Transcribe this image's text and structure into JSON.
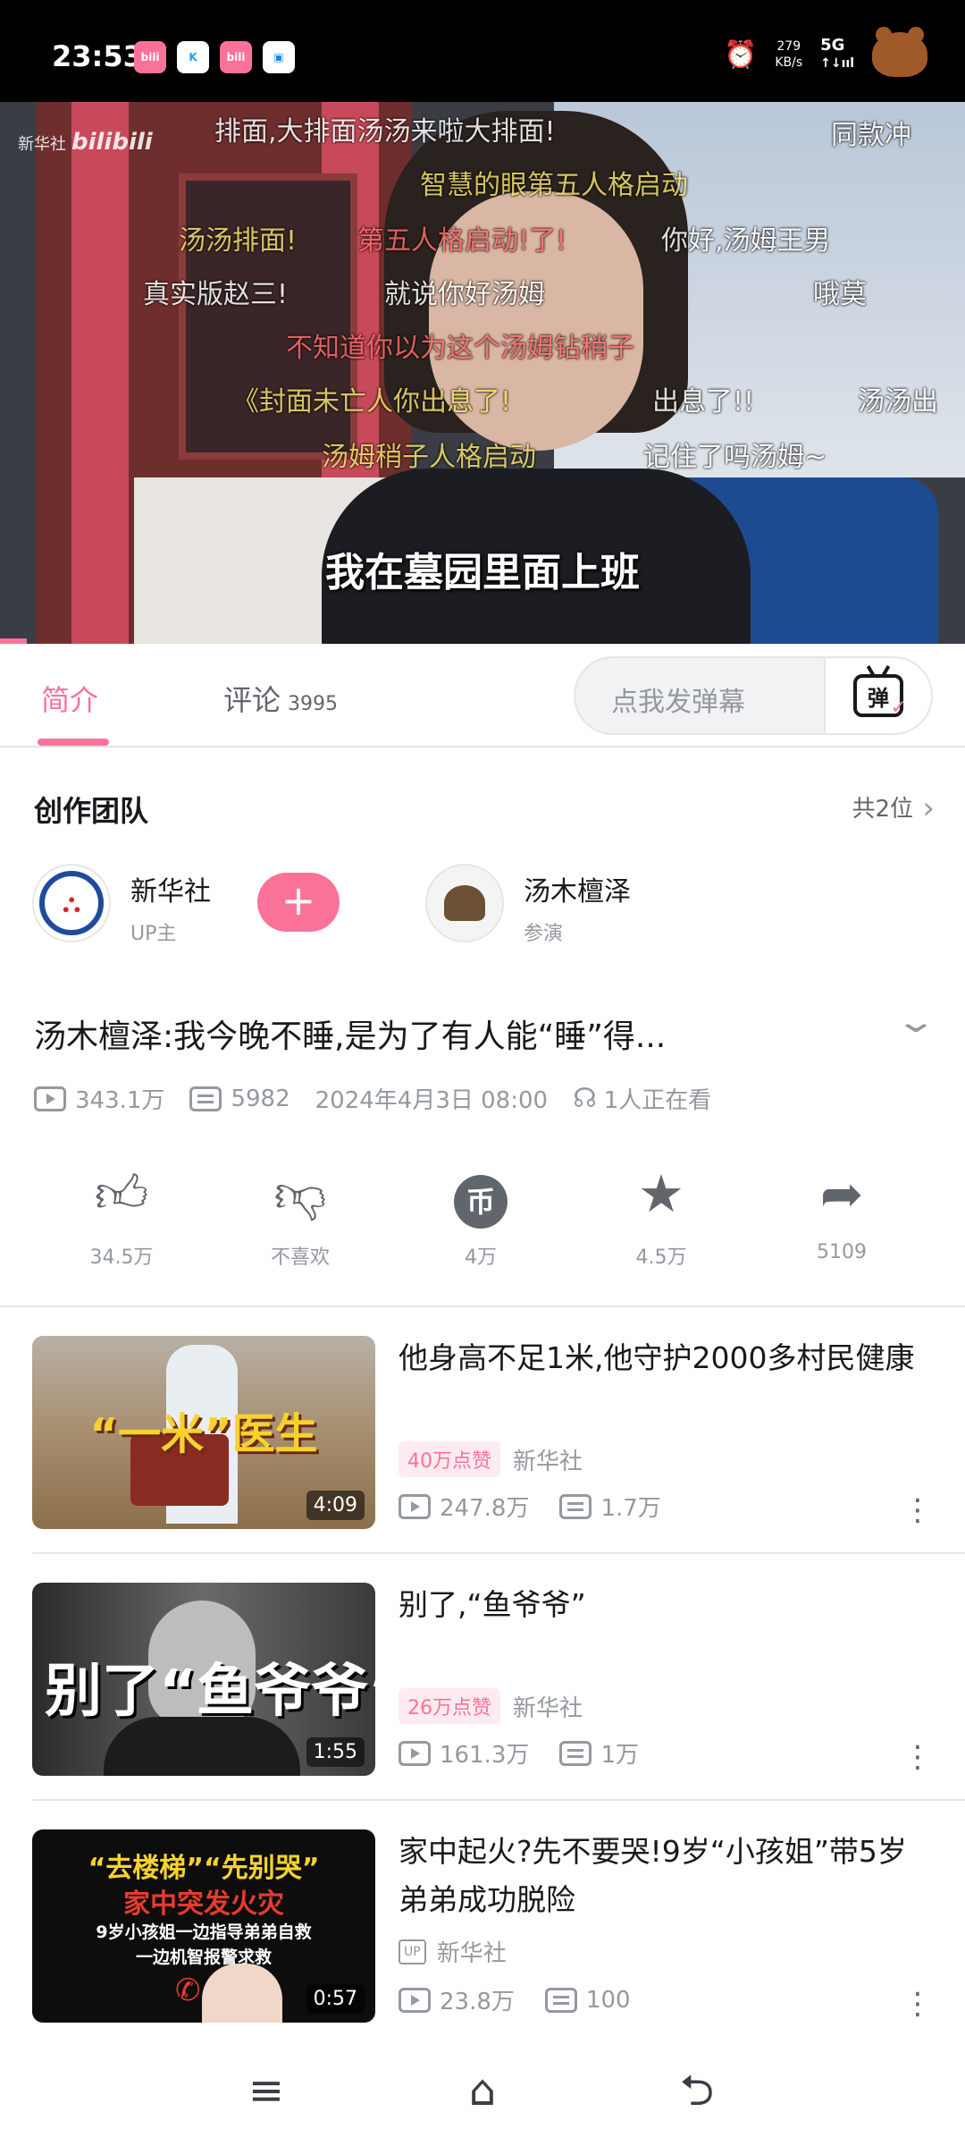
{
  "status_bar": {
    "time": "23:53",
    "apps": [
      {
        "icon": "bilibili-app-icon",
        "text": "bili",
        "color": "#fb7299"
      },
      {
        "icon": "k-app-icon",
        "text": "K",
        "color": "#1e9ff2"
      },
      {
        "icon": "bilibili-app-icon",
        "text": "bili",
        "color": "#fb7299"
      },
      {
        "icon": "tv-app-icon",
        "text": "▣",
        "color": "#1e88e5"
      }
    ],
    "alarm_icon": "alarm-icon",
    "speed_value": "279",
    "speed_unit": "KB/s",
    "network": "5G",
    "signal": "↑↓ııl"
  },
  "video": {
    "channel_logo": "新华社",
    "platform_logo": "bilibili",
    "subtitle": "我在墓园里面上班",
    "danmaku": [
      "排面,大排面汤汤来啦大排面!",
      "同款冲",
      "智慧的眼第五人格启动",
      "汤汤排面!",
      "第五人格启动!了!",
      "你好,汤姆王男",
      "真实版赵三!",
      "就说你好汤姆",
      "哦莫",
      "不知道你以为这个汤姆钻稍子",
      "《封面未亡人你出息了!",
      "出息了!!",
      "汤汤出",
      "汤姆稍子人格启动",
      "记住了吗汤姆~"
    ]
  },
  "tabs": [
    {
      "label": "简介",
      "count": ""
    },
    {
      "label": "评论",
      "count": "3995"
    }
  ],
  "danmu": {
    "placeholder": "点我发弹幕",
    "button": "弹"
  },
  "team": {
    "title": "创作团队",
    "count": "共2位",
    "members": [
      {
        "name": "新华社",
        "role": "UP主"
      },
      {
        "name": "汤木檀泽",
        "role": "参演"
      }
    ]
  },
  "video_info": {
    "title": "汤木檀泽:我今晚不睡,是为了有人能“睡”得...",
    "views": "343.1万",
    "danmaku_count": "5982",
    "date": "2024年4月3日 08:00",
    "watching": "1人正在看"
  },
  "actions": [
    {
      "icon": "thumbs-up-icon",
      "label": "34.5万"
    },
    {
      "icon": "thumbs-down-icon",
      "label": "不喜欢"
    },
    {
      "icon": "coin-icon",
      "label": "4万",
      "glyph": "币"
    },
    {
      "icon": "star-icon",
      "label": "4.5万"
    },
    {
      "icon": "share-icon",
      "label": "5109"
    }
  ],
  "related": [
    {
      "title": "他身高不足1米,他守护2000多村民健康",
      "duration": "4:09",
      "thumb_text": "“一米”医生",
      "badge": "40万点赞",
      "author": "新华社",
      "views": "247.8万",
      "danmaku": "1.7万"
    },
    {
      "title": "别了,“鱼爷爷”",
      "duration": "1:55",
      "thumb_text": "别了“鱼爷爷”",
      "badge": "26万点赞",
      "author": "新华社",
      "views": "161.3万",
      "danmaku": "1万"
    },
    {
      "title": "家中起火?先不要哭!9岁“小孩姐”带5岁弟弟成功脱险",
      "duration": "0:57",
      "thumb_line1": "“去楼梯”“先别哭”",
      "thumb_line2": "家中突发火灾",
      "thumb_line3": "9岁小孩姐一边指导弟弟自救",
      "thumb_line4": "一边机智报警求救",
      "up_tag": "UP",
      "author": "新华社",
      "views": "23.8万",
      "danmaku": "100"
    }
  ],
  "navbar": {
    "menu": "≡",
    "home": "⌂",
    "back": "⮌"
  }
}
